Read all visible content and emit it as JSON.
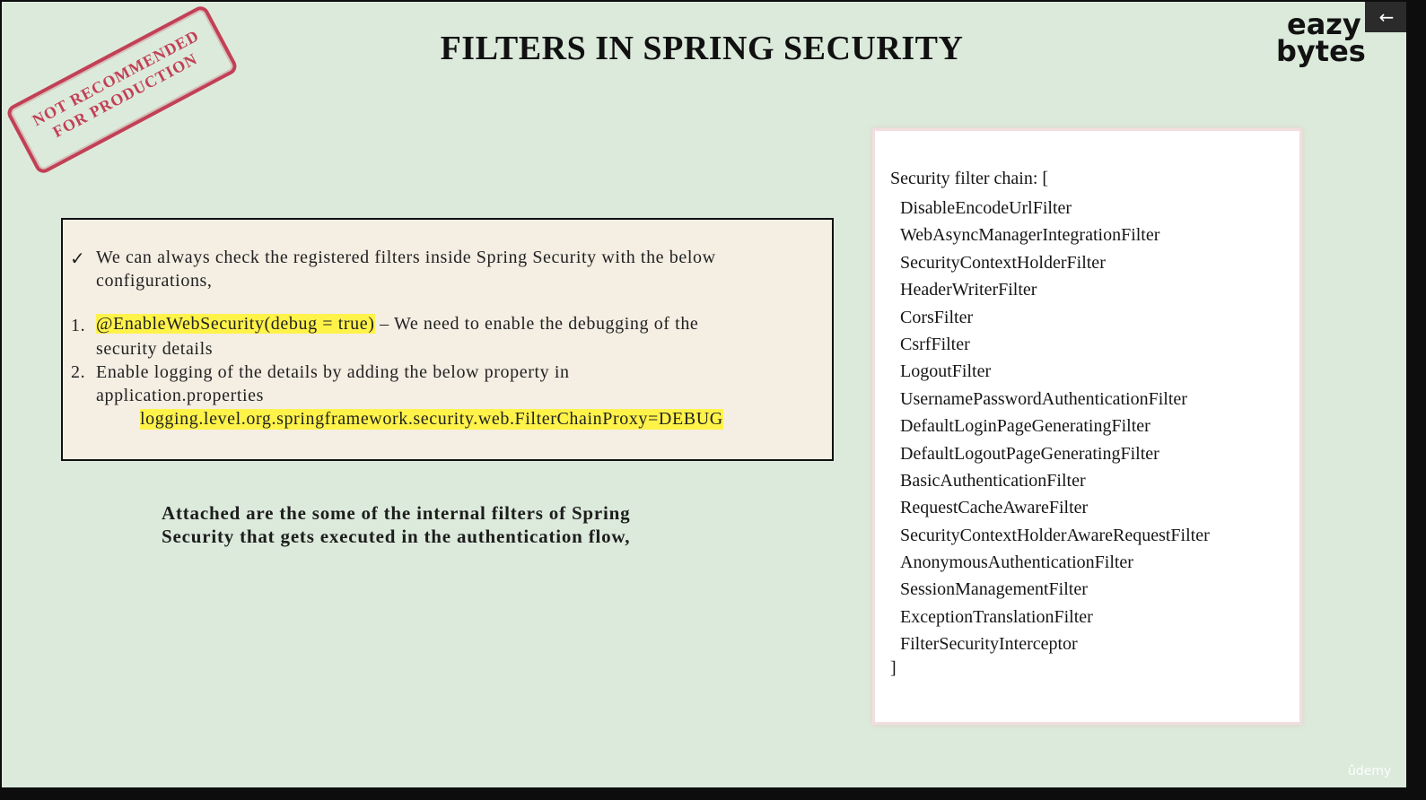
{
  "title": "FILTERS IN SPRING SECURITY",
  "logo": {
    "line1": "eazy",
    "line2": "bytes"
  },
  "back_button": {
    "icon": "←"
  },
  "stamp": {
    "line1": "NOT RECOMMENDED",
    "line2": "FOR PRODUCTION"
  },
  "info": {
    "check_icon": "✓",
    "intro_line1": "We can always check the registered filters inside Spring Security with the below",
    "intro_line2": "configurations,",
    "item1_number": "1.",
    "item1_code": "@EnableWebSecurity(debug = true)",
    "item1_text": "– We need to enable the debugging of  the",
    "item1_line2": "security details",
    "item2_number": "2.",
    "item2_text": "Enable logging of  the details by adding the below property in",
    "item2_line2": "application.properties",
    "property": "logging.level.org.springframework.security.web.FilterChainProxy=DEBUG"
  },
  "caption": {
    "line1": "Attached are the some of  the internal filters of  Spring",
    "line2": "Security that gets executed in the authentication flow,"
  },
  "chain": {
    "header": "Security filter chain: [",
    "filters": [
      "DisableEncodeUrlFilter",
      "WebAsyncManagerIntegrationFilter",
      "SecurityContextHolderFilter",
      "HeaderWriterFilter",
      "CorsFilter",
      "CsrfFilter",
      "LogoutFilter",
      "UsernamePasswordAuthenticationFilter",
      "DefaultLoginPageGeneratingFilter",
      "DefaultLogoutPageGeneratingFilter",
      "BasicAuthenticationFilter",
      "RequestCacheAwareFilter",
      "SecurityContextHolderAwareRequestFilter",
      "AnonymousAuthenticationFilter",
      "SessionManagementFilter",
      "ExceptionTranslationFilter",
      "FilterSecurityInterceptor"
    ],
    "close": "]"
  },
  "watermark": "ûdemy"
}
